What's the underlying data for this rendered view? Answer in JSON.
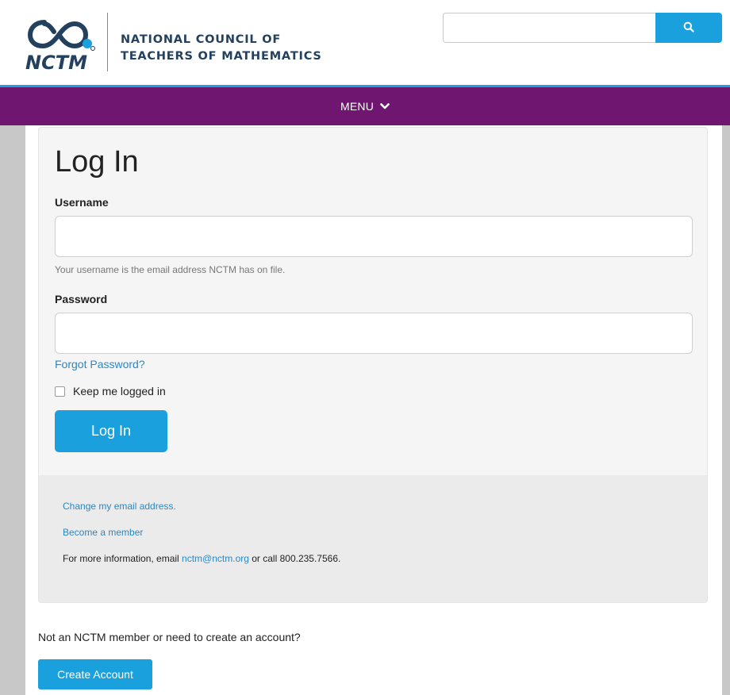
{
  "header": {
    "logo_abbrev": "NCTM",
    "org_line1": "NATIONAL COUNCIL OF",
    "org_line2": "TEACHERS OF MATHEMATICS",
    "search": {
      "placeholder": "",
      "value": "",
      "icon": "search-icon"
    }
  },
  "nav": {
    "menu_label": "MENU",
    "menu_icon": "chevron-down-icon"
  },
  "login": {
    "title": "Log In",
    "username_label": "Username",
    "username_value": "",
    "username_help": "Your username is the email address NCTM has on file.",
    "password_label": "Password",
    "password_value": "",
    "forgot_link": "Forgot Password?",
    "remember_label": "Keep me logged in",
    "remember_checked": false,
    "submit_label": "Log In"
  },
  "links": {
    "change_email": "Change my email address.",
    "become_member": "Become a member",
    "info_prefix": "For more information, email ",
    "info_email": "nctm@nctm.org",
    "info_suffix": " or call 800.235.7566."
  },
  "signup": {
    "prompt": "Not an NCTM member or need to create an account?",
    "button_label": "Create Account"
  },
  "colors": {
    "accent_blue": "#1aa0dc",
    "menu_purple": "#6e1670",
    "link_blue": "#2a88c4",
    "brand_navy": "#23405f"
  }
}
